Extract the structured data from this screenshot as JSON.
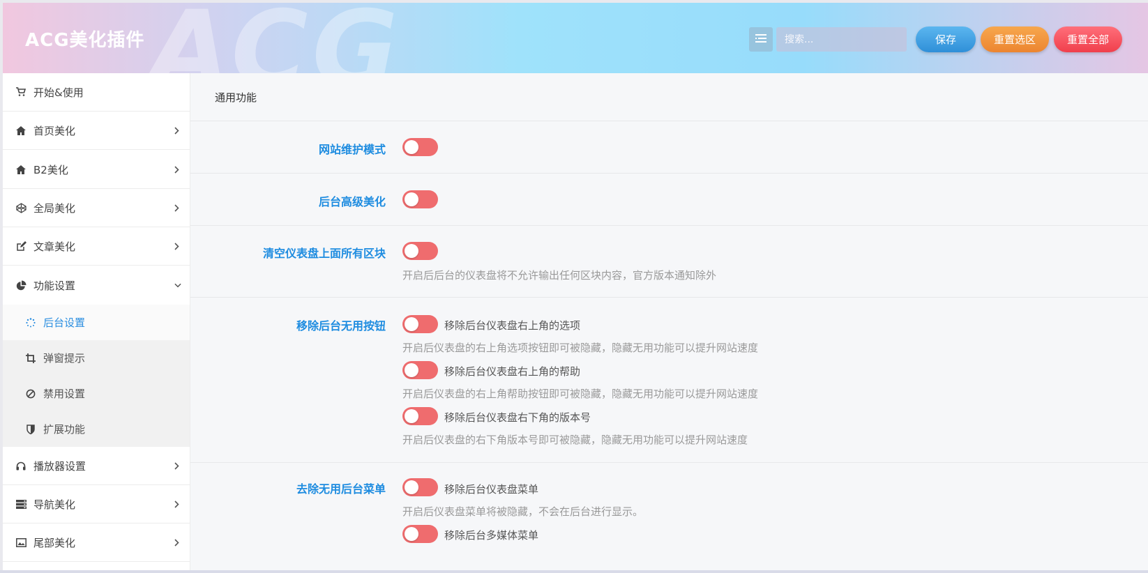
{
  "header": {
    "brand": "ACG美化插件",
    "watermark": "ACG",
    "search_placeholder": "搜索...",
    "buttons": {
      "save": "保存",
      "reset_section": "重置选区",
      "reset_all": "重置全部"
    }
  },
  "sidebar": {
    "items": [
      {
        "label": "开始&使用",
        "icon": "cart-icon"
      },
      {
        "label": "首页美化",
        "icon": "home-icon"
      },
      {
        "label": "B2美化",
        "icon": "home-icon"
      },
      {
        "label": "全局美化",
        "icon": "codepen-icon"
      },
      {
        "label": "文章美化",
        "icon": "edit-icon"
      },
      {
        "label": "功能设置",
        "icon": "pie-chart-icon"
      },
      {
        "label": "播放器设置",
        "icon": "headphones-icon"
      },
      {
        "label": "导航美化",
        "icon": "server-icon"
      },
      {
        "label": "尾部美化",
        "icon": "image-icon"
      }
    ],
    "sub_items": [
      {
        "label": "后台设置",
        "icon": "spinner-icon",
        "active": true
      },
      {
        "label": "弹窗提示",
        "icon": "crop-icon"
      },
      {
        "label": "禁用设置",
        "icon": "ban-icon"
      },
      {
        "label": "扩展功能",
        "icon": "shield-icon"
      }
    ]
  },
  "main": {
    "section_title": "通用功能",
    "fields": {
      "maintenance": {
        "label": "网站维护模式"
      },
      "admin_beautify": {
        "label": "后台高级美化"
      },
      "clear_dashboard": {
        "label": "清空仪表盘上面所有区块",
        "desc": "开启后后台的仪表盘将不允许输出任何区块内容，官方版本通知除外"
      },
      "remove_buttons": {
        "label": "移除后台无用按钮",
        "options": [
          {
            "text": "移除后台仪表盘右上角的选项",
            "desc": "开启后仪表盘的右上角选项按钮即可被隐藏，隐藏无用功能可以提升网站速度"
          },
          {
            "text": "移除后台仪表盘右上角的帮助",
            "desc": "开启后仪表盘的右上角帮助按钮即可被隐藏，隐藏无用功能可以提升网站速度"
          },
          {
            "text": "移除后台仪表盘右下角的版本号",
            "desc": "开启后仪表盘的右下角版本号即可被隐藏，隐藏无用功能可以提升网站速度"
          }
        ]
      },
      "remove_menus": {
        "label": "去除无用后台菜单",
        "options": [
          {
            "text": "移除后台仪表盘菜单",
            "desc": "开启后仪表盘菜单将被隐藏，不会在后台进行显示。"
          },
          {
            "text": "移除后台多媒体菜单"
          }
        ]
      }
    }
  },
  "colors": {
    "accent": "#1e8ce0",
    "toggle_off": "#ef6c6e",
    "save": "#2f8fd8",
    "reset_section": "#ec8530",
    "reset_all": "#f03f4c"
  }
}
